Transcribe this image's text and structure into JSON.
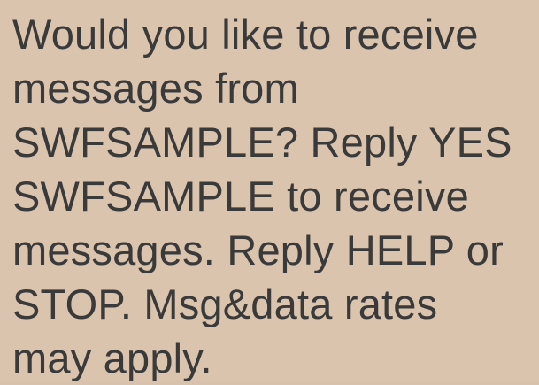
{
  "message": {
    "lines": [
      "Would you like to receive",
      "messages from",
      "SWFSAMPLE? Reply YES",
      "SWFSAMPLE to receive",
      "messages. Reply HELP or",
      "STOP. Msg&data rates",
      "may apply."
    ]
  },
  "colors": {
    "bubble_background": "#dbc4ae",
    "text": "#3a3a3a"
  }
}
